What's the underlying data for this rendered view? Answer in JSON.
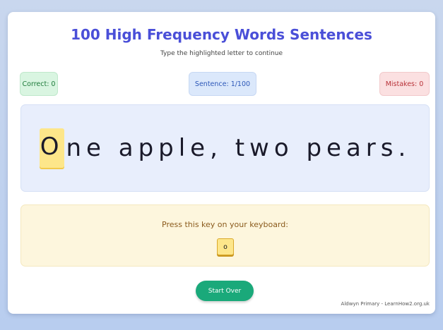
{
  "header": {
    "title": "100 High Frequency Words Sentences",
    "subtitle": "Type the highlighted letter to continue"
  },
  "stats": {
    "correct_label": "Correct:",
    "correct_value": "0",
    "sentence_label": "Sentence:",
    "sentence_value": "1/100",
    "mistakes_label": "Mistakes:",
    "mistakes_value": "0"
  },
  "sentence": {
    "highlighted_letter": "O",
    "remaining_text": "ne apple, two pears."
  },
  "key_prompt": {
    "label": "Press this key on your keyboard:",
    "key": "o"
  },
  "actions": {
    "start_over_label": "Start Over"
  },
  "footer": {
    "credit": "Aldwyn Primary - LearnHow2.org.uk"
  },
  "colors": {
    "title": "#4a4fd8",
    "highlight": "#fde68a",
    "button": "#1aa97a"
  }
}
